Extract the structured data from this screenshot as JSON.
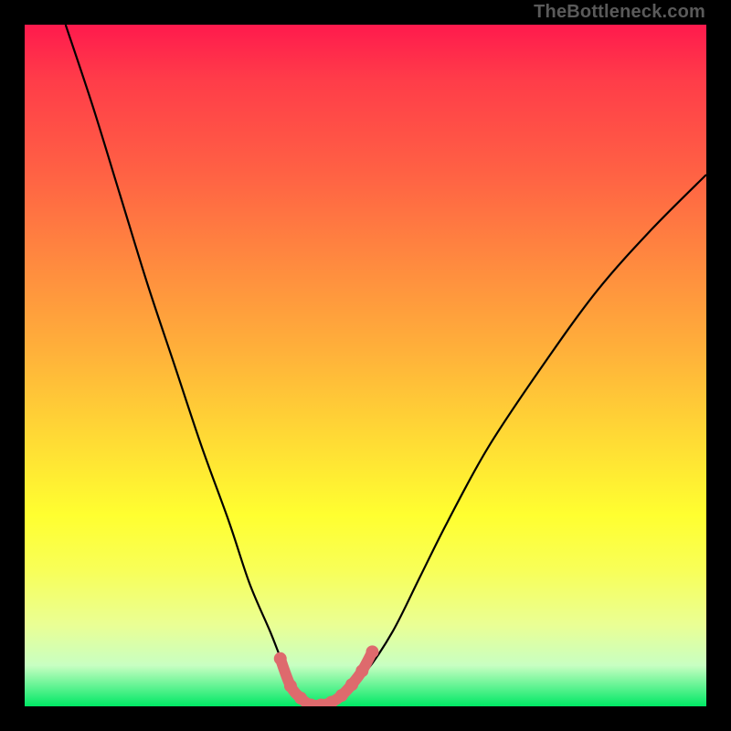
{
  "watermark": "TheBottleneck.com",
  "chart_data": {
    "type": "line",
    "title": "",
    "xlabel": "",
    "ylabel": "",
    "xlim": [
      0,
      100
    ],
    "ylim": [
      0,
      100
    ],
    "grid": false,
    "legend": false,
    "series": [
      {
        "name": "bottleneck-curve",
        "x": [
          6,
          10,
          14,
          18,
          22,
          26,
          30,
          33,
          36,
          38,
          40,
          42,
          44,
          46,
          50,
          54,
          58,
          62,
          68,
          76,
          84,
          92,
          100
        ],
        "y": [
          100,
          88,
          75,
          62,
          50,
          38,
          27,
          18,
          11,
          6,
          2,
          0,
          0,
          1,
          5,
          11,
          19,
          27,
          38,
          50,
          61,
          70,
          78
        ]
      }
    ],
    "marker_points": {
      "name": "sweet-spot-markers",
      "color": "#de6a6d",
      "x": [
        37.5,
        39.0,
        40.5,
        42.0,
        43.5,
        45.0,
        46.5,
        48.0,
        49.5,
        51.0
      ],
      "y": [
        7.0,
        3.0,
        1.2,
        0.2,
        0.2,
        0.6,
        1.6,
        3.2,
        5.2,
        8.0
      ]
    },
    "background": {
      "type": "vertical-gradient",
      "stops": [
        {
          "pos": 0.0,
          "color": "#ff1a4d"
        },
        {
          "pos": 0.6,
          "color": "#ffd835"
        },
        {
          "pos": 0.8,
          "color": "#f8ff58"
        },
        {
          "pos": 1.0,
          "color": "#00e865"
        }
      ]
    }
  }
}
